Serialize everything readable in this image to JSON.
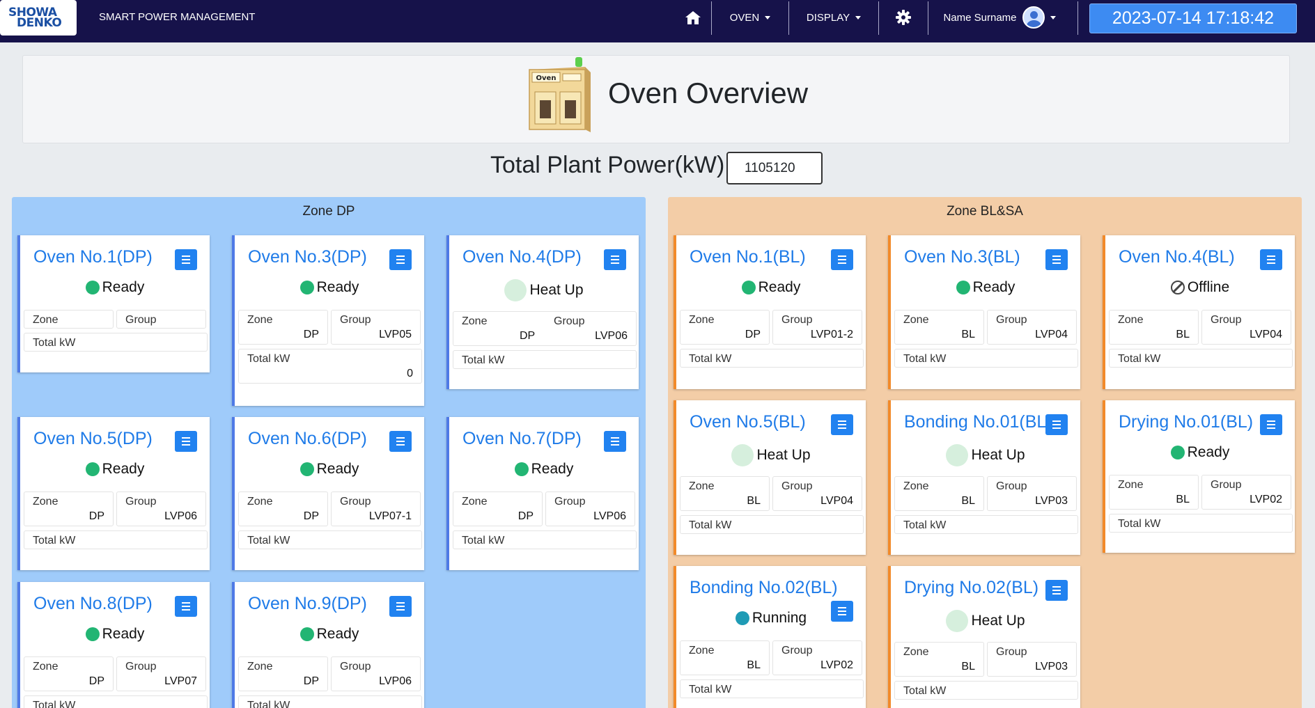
{
  "navbar": {
    "logo_top": "SHOWA",
    "logo_bottom": "DENKO",
    "brand": "SMART POWER MANAGEMENT",
    "home_icon": "home-icon",
    "oven_menu": "OVEN",
    "display_menu": "DISPLAY",
    "settings_icon": "gear-icon",
    "user_name": "Name Surname",
    "user_icon": "avatar-icon",
    "datetime": "2023-07-14 17:18:42"
  },
  "header": {
    "icon_label": "Oven",
    "title": "Oven Overview",
    "total_power_label": "Total Plant Power(kW)",
    "total_power_value": "1105120"
  },
  "labels": {
    "zone": "Zone",
    "group": "Group",
    "total": "Total kW"
  },
  "zones": [
    {
      "title": "Zone DP",
      "color": "#9fcbfa",
      "cards": [
        {
          "name": "Oven No.1(DP)",
          "status": "Ready",
          "zone": "",
          "group": "",
          "total": ""
        },
        {
          "name": "Oven No.3(DP)",
          "status": "Ready",
          "zone": "DP",
          "group": "LVP05",
          "total": "0"
        },
        {
          "name": "Oven No.4(DP)",
          "status": "Heat Up",
          "zone": "DP",
          "group": "LVP06",
          "total": ""
        },
        {
          "name": "Oven No.5(DP)",
          "status": "Ready",
          "zone": "DP",
          "group": "LVP06",
          "total": ""
        },
        {
          "name": "Oven No.6(DP)",
          "status": "Ready",
          "zone": "DP",
          "group": "LVP07-1",
          "total": ""
        },
        {
          "name": "Oven No.7(DP)",
          "status": "Ready",
          "zone": "DP",
          "group": "LVP06",
          "total": ""
        },
        {
          "name": "Oven No.8(DP)",
          "status": "Ready",
          "zone": "DP",
          "group": "LVP07",
          "total": ""
        },
        {
          "name": "Oven No.9(DP)",
          "status": "Ready",
          "zone": "DP",
          "group": "LVP06",
          "total": ""
        }
      ]
    },
    {
      "title": "Zone BL&SA",
      "color": "#f3cda7",
      "cards": [
        {
          "name": "Oven No.1(BL)",
          "status": "Ready",
          "zone": "DP",
          "group": "LVP01-2",
          "total": ""
        },
        {
          "name": "Oven No.3(BL)",
          "status": "Ready",
          "zone": "BL",
          "group": "LVP04",
          "total": ""
        },
        {
          "name": "Oven No.4(BL)",
          "status": "Offline",
          "zone": "BL",
          "group": "LVP04",
          "total": ""
        },
        {
          "name": "Oven No.5(BL)",
          "status": "Heat Up",
          "zone": "BL",
          "group": "LVP04",
          "total": ""
        },
        {
          "name": "Bonding No.01(BL)",
          "status": "Heat Up",
          "zone": "BL",
          "group": "LVP03",
          "total": ""
        },
        {
          "name": "Drying No.01(BL)",
          "status": "Ready",
          "zone": "BL",
          "group": "LVP02",
          "total": ""
        },
        {
          "name": "Bonding No.02(BL)",
          "status": "Running",
          "zone": "BL",
          "group": "LVP02",
          "total": ""
        },
        {
          "name": "Drying No.02(BL)",
          "status": "Heat Up",
          "zone": "BL",
          "group": "LVP03",
          "total": ""
        }
      ]
    }
  ],
  "status_colors": {
    "Ready": "#22b573",
    "Heat Up": "#d6efdd",
    "Running": "#1f9bb5",
    "Offline": "#444444"
  }
}
